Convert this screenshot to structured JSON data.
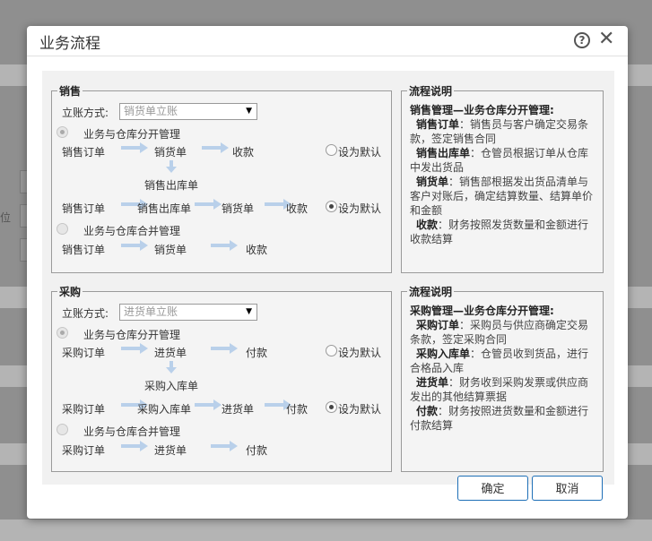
{
  "dialog": {
    "title": "业务流程",
    "ok_label": "确定",
    "cancel_label": "取消"
  },
  "background": {
    "side_label": "位"
  },
  "sales": {
    "legend": "销售",
    "account_label": "立账方式:",
    "account_value": "销货单立账",
    "separate_option": "业务与仓库分开管理",
    "merged_option": "业务与仓库合并管理",
    "set_default": "设为默认",
    "flow1": [
      "销售订单",
      "销货单",
      "收款"
    ],
    "warehouse_doc": "销售出库单",
    "flow2": [
      "销售订单",
      "销售出库单",
      "销货单",
      "收款"
    ],
    "flow3": [
      "销售订单",
      "销货单",
      "收款"
    ],
    "desc": {
      "legend": "流程说明",
      "heading": "销售管理—业务仓库分开管理:",
      "items": [
        {
          "term": "销售订单",
          "text": "：销售员与客户确定交易条款，签定销售合同"
        },
        {
          "term": "销售出库单",
          "text": "：仓管员根据订单从仓库中发出货品"
        },
        {
          "term": "销货单",
          "text": "：销售部根据发出货品清单与客户对账后，确定结算数量、结算单价和金额"
        },
        {
          "term": "收款",
          "text": "：财务按照发货数量和金额进行收款结算"
        }
      ]
    }
  },
  "purchase": {
    "legend": "采购",
    "account_label": "立账方式:",
    "account_value": "进货单立账",
    "separate_option": "业务与仓库分开管理",
    "merged_option": "业务与仓库合并管理",
    "set_default": "设为默认",
    "flow1": [
      "采购订单",
      "进货单",
      "付款"
    ],
    "warehouse_doc": "采购入库单",
    "flow2": [
      "采购订单",
      "采购入库单",
      "进货单",
      "付款"
    ],
    "flow3": [
      "采购订单",
      "进货单",
      "付款"
    ],
    "desc": {
      "legend": "流程说明",
      "heading": "采购管理—业务仓库分开管理:",
      "items": [
        {
          "term": "采购订单",
          "text": "：采购员与供应商确定交易条款，签定采购合同"
        },
        {
          "term": "采购入库单",
          "text": "：仓管员收到货品，进行合格品入库"
        },
        {
          "term": "进货单",
          "text": "：财务收到采购发票或供应商发出的其他结算票据"
        },
        {
          "term": "付款",
          "text": "：财务按照进货数量和金额进行付款结算"
        }
      ]
    }
  },
  "colors": {
    "arrow": "#b9d0ea",
    "button_border": "#1e6fb7"
  }
}
